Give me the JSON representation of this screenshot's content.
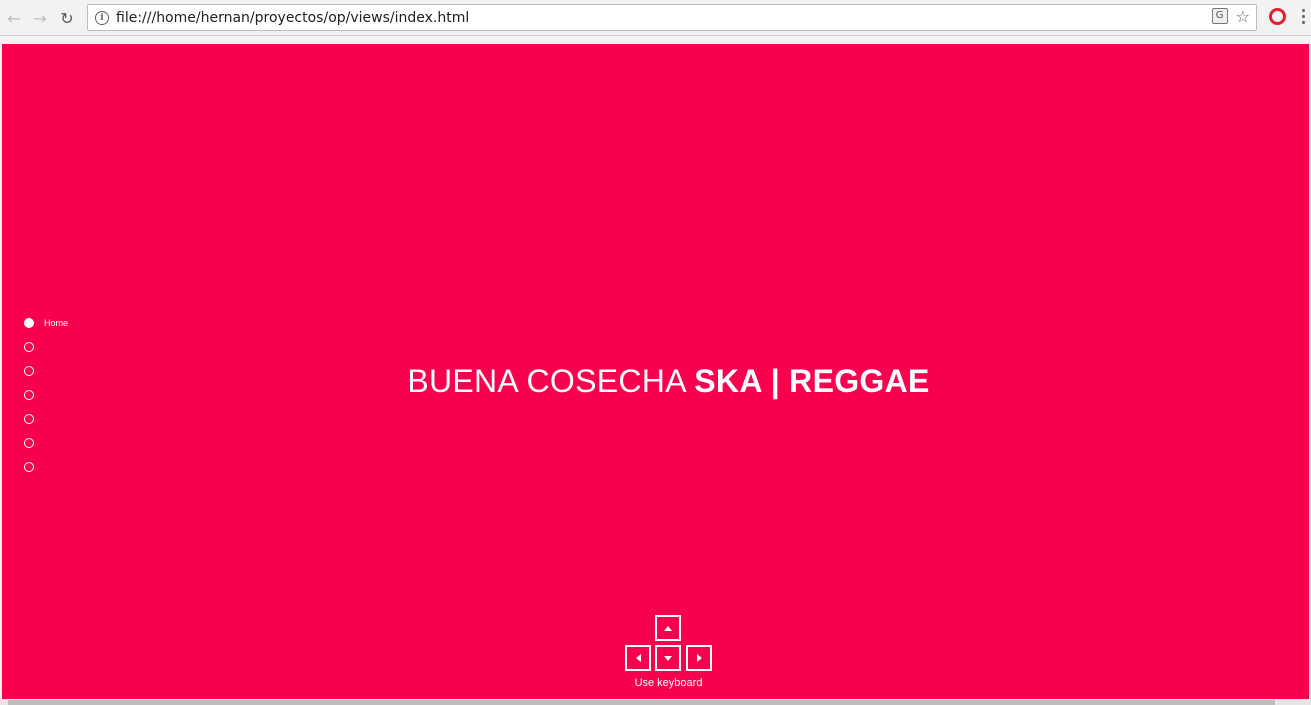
{
  "browser": {
    "url": "file:///home/hernan/proyectos/op/views/index.html",
    "icons": {
      "back": "back-arrow-icon",
      "forward": "forward-arrow-icon",
      "reload": "reload-icon",
      "info": "info-icon",
      "translate": "translate-icon",
      "bookmark": "star-icon",
      "opera": "opera-icon",
      "menu": "kebab-menu-icon"
    }
  },
  "page": {
    "background": "#f7004f",
    "nav": {
      "items": [
        {
          "label": "Home",
          "active": true
        },
        {
          "label": "",
          "active": false
        },
        {
          "label": "",
          "active": false
        },
        {
          "label": "",
          "active": false
        },
        {
          "label": "",
          "active": false
        },
        {
          "label": "",
          "active": false
        },
        {
          "label": "",
          "active": false
        }
      ]
    },
    "headline": {
      "light": "BUENA COSECHA ",
      "bold": "SKA | REGGAE"
    },
    "keyboard_hint": "Use keyboard"
  }
}
